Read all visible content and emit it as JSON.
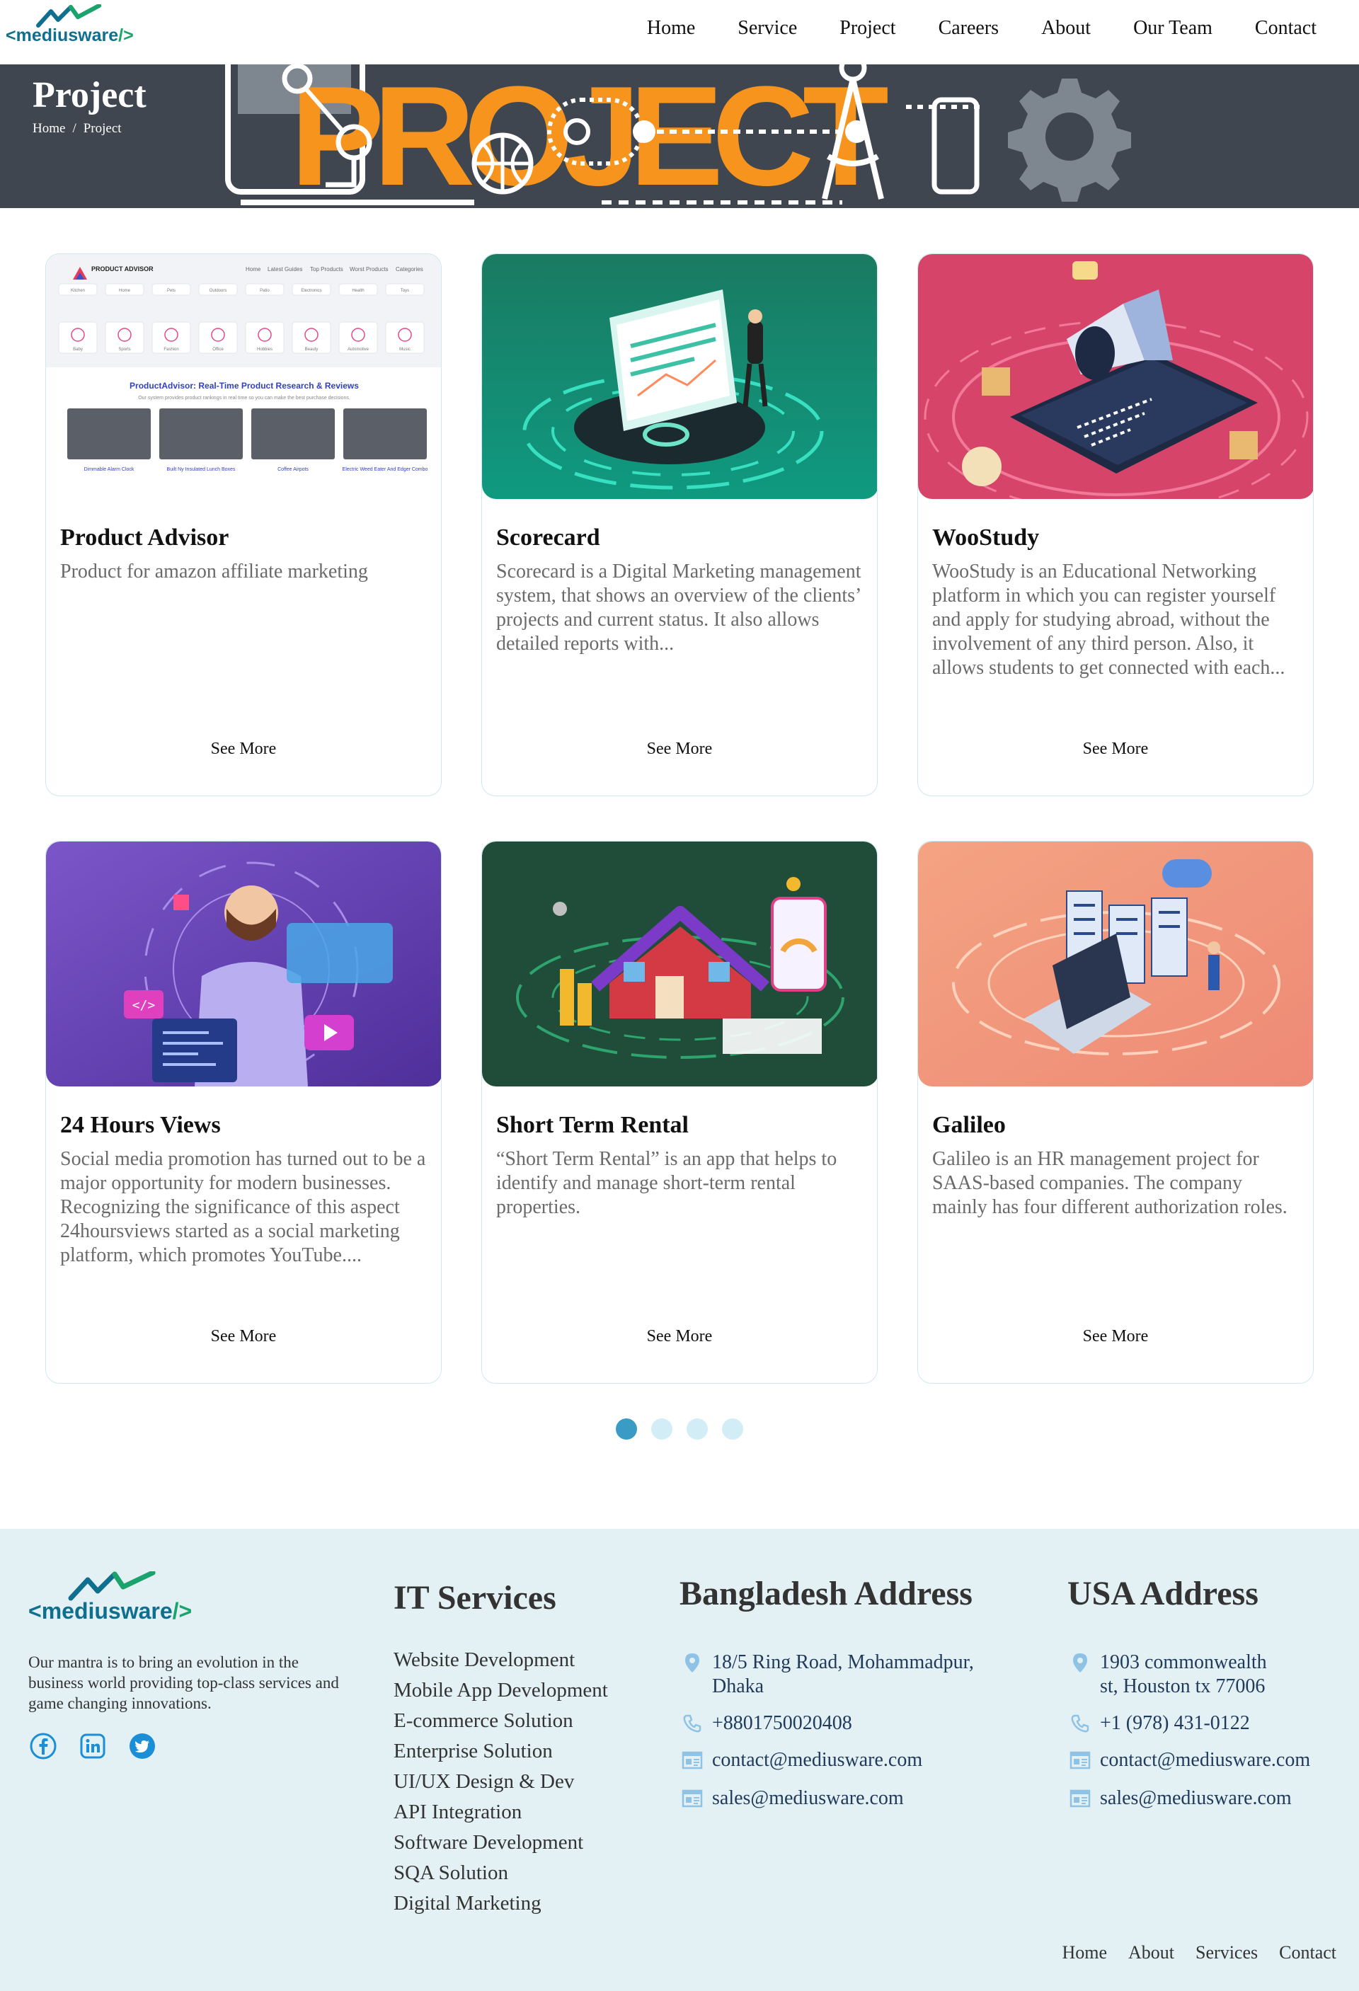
{
  "brand": {
    "name": "mediusware",
    "prefix": "<",
    "suffix": "/>"
  },
  "nav": {
    "items": [
      "Home",
      "Service",
      "Project",
      "Careers",
      "About",
      "Our Team",
      "Contact"
    ]
  },
  "hero": {
    "title": "Project",
    "breadcrumb": [
      "Home",
      "/",
      "Project"
    ],
    "art_text": "PROJECT"
  },
  "cards": [
    {
      "title": "Product Advisor",
      "desc": "Product for amazon affiliate marketing",
      "more": "See More"
    },
    {
      "title": "Scorecard",
      "desc": "Scorecard is a Digital Marketing management system, that shows an overview of the clients’ projects and current status. It also allows detailed reports with...",
      "more": "See More"
    },
    {
      "title": "WooStudy",
      "desc": "WooStudy is an Educational Networking platform in which you can register yourself and apply for studying abroad, without the involvement of any third person. Also, it allows students to get connected with each...",
      "more": "See More"
    },
    {
      "title": "24 Hours Views",
      "desc": "Social media promotion has turned out to be a major opportunity for modern businesses. Recognizing the significance of this aspect 24hoursviews started as a social marketing platform, which promotes YouTube....",
      "more": "See More"
    },
    {
      "title": "Short Term Rental",
      "desc": "“Short Term Rental” is an app that helps to identify and manage short-term rental properties.",
      "more": "See More"
    },
    {
      "title": "Galileo",
      "desc": "Galileo is an HR management project for SAAS-based companies. The company mainly has four different authorization roles.",
      "more": "See More"
    }
  ],
  "thumb_pa": {
    "logo": "PRODUCT ADVISOR",
    "menu": [
      "Home",
      "Latest Guides",
      "Top Products",
      "Worst Products",
      "Categories"
    ],
    "cats": [
      "Kitchen",
      "Home",
      "Pets",
      "Outdoors",
      "Patio",
      "Electronics",
      "Health",
      "Toys",
      "Baby",
      "Sports",
      "Fashion",
      "Office",
      "Hobbies",
      "Beauty",
      "Automotive",
      "Music"
    ],
    "headline": "ProductAdvisor: Real-Time Product Research & Reviews",
    "sub": "Our system provides product rankings in real time so you can make the best purchase decisions.",
    "products": [
      "Dimmable Alarm Clock",
      "Built Ny Insulated Lunch Boxes",
      "Coffee Airpots",
      "Electric Weed Eater And Edger Combo"
    ]
  },
  "pagination": {
    "count": 4,
    "active": 0
  },
  "footer": {
    "mantra": "Our mantra is to bring an evolution in the business world providing top-class services and game changing innovations.",
    "socials": [
      "facebook-icon",
      "linkedin-icon",
      "twitter-icon"
    ],
    "services_title": "IT Services",
    "services": [
      "Website Development",
      "Mobile App Development",
      "E-commerce Solution",
      "Enterprise Solution",
      "UI/UX Design & Dev",
      "API Integration",
      "Software Development",
      "SQA Solution",
      "Digital Marketing"
    ],
    "bd": {
      "title": "Bangladesh Address",
      "address": "18/5 Ring Road, Mohammadpur, Dhaka",
      "phone": "+8801750020408",
      "email1": "contact@mediusware.com",
      "email2": "sales@mediusware.com"
    },
    "usa": {
      "title": "USA Address",
      "address": "1903 commonwealth st, Houston tx 77006",
      "phone": "+1 (978) 431-0122",
      "email1": "contact@mediusware.com",
      "email2": "sales@mediusware.com"
    },
    "links": [
      "Home",
      "About",
      "Services",
      "Contact"
    ]
  },
  "colors": {
    "accent": "#3a9cc4",
    "hero_bg": "#3f4650",
    "hero_orange": "#f7941d",
    "footer_bg": "#e3f0f4",
    "brand": "#0f6f8f"
  }
}
